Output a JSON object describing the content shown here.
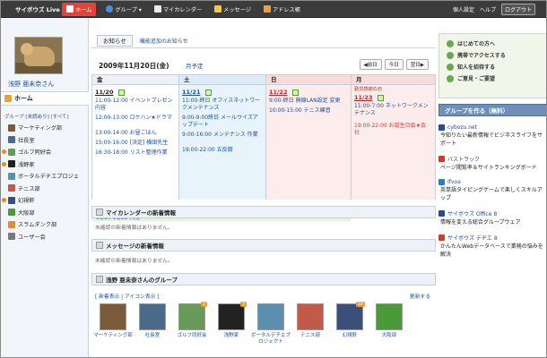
{
  "topbar": {
    "logo": "サイボウズ Live",
    "nav": [
      {
        "label": "ホーム",
        "active": true
      },
      {
        "label": "グループ ▾"
      },
      {
        "label": "マイカレンダー"
      },
      {
        "label": "メッセージ"
      },
      {
        "label": "アドレス帳"
      }
    ],
    "right": [
      "個人設定",
      "ヘルプ"
    ],
    "logout": "ログアウト"
  },
  "sidebar": {
    "username": "浅野 亜未奈さん",
    "home": "ホーム",
    "group_header": "グループ",
    "filter_unread": "[未読あり]",
    "filter_all": "[すべて]",
    "groups": [
      {
        "label": "マーケティング部",
        "dot": false
      },
      {
        "label": "社長室",
        "dot": false
      },
      {
        "label": "ゴルフ同好会",
        "dot": true
      },
      {
        "label": "浅野家",
        "dot": true
      },
      {
        "label": "ボータルデチエプロジェ",
        "dot": false
      },
      {
        "label": "テニス部",
        "dot": false
      },
      {
        "label": "幻視軒",
        "dot": true
      },
      {
        "label": "大阪部",
        "dot": false
      },
      {
        "label": "スラムダンク部",
        "dot": false
      },
      {
        "label": "ユーザー会",
        "dot": false
      }
    ]
  },
  "main": {
    "tab": "お知らせ",
    "breadcrumb_link": "機能追加のお知らせ",
    "calendar": {
      "date_title": "2009年11月20日(金)",
      "month_link": "月予定",
      "prev": "◀前日",
      "today": "今日",
      "next": "翌日▶",
      "columns": [
        {
          "head": "金",
          "date": "11/20",
          "holiday": "",
          "events": [
            {
              "time": "11:00-12:00",
              "text": "イベントプレゼン内容"
            },
            {
              "time": "12:00-13:00",
              "text": "ロケハン★ドラマ"
            },
            {
              "time": "13:00-14:00",
              "text": "お昼ごはん"
            },
            {
              "time": "15:00-16:00",
              "text": "[決定] 横田先生"
            },
            {
              "time": "16:30-18:00",
              "text": "リスト整理作業"
            }
          ]
        },
        {
          "head": "土",
          "date": "11/21",
          "holiday": "",
          "events": [
            {
              "time": "11:00-終日",
              "text": "オフィスネットワークメンテナンス"
            },
            {
              "time": "9:00-9:00終日",
              "text": "メールウイズアップデート"
            },
            {
              "time": "9:00-16:00",
              "text": "メンテナンス 作業"
            },
            {
              "time": "19:00-22:00",
              "text": "五反田"
            }
          ]
        },
        {
          "head": "日",
          "date": "11/22",
          "holiday": "",
          "events": [
            {
              "time": "9:00-終日",
              "text": "無線LAN設定 変更"
            },
            {
              "time": "10:00-15:00",
              "text": "テニス練習"
            }
          ]
        },
        {
          "head": "月",
          "date": "11/23",
          "holiday": "勤労感謝の日",
          "events": [
            {
              "time": "11:00-7:00",
              "text": "ネットワークメンテナンス"
            },
            {
              "time": "19:00-22:00",
              "text": "お誕生日会★会 社",
              "red": true
            }
          ]
        }
      ],
      "multiday": "11/20-11/22  大阪"
    },
    "mycal_title": "マイカレンダーの新着情報",
    "mycal_empty": "未確認の新着情報はありません。",
    "msg_title": "メッセージの新着情報",
    "msg_empty": "未確認の新着情報はありません。",
    "groups_title": "浅野 亜未奈さんのグループ",
    "groups_opts": "[ 新着表示 | アイコン表示 ]",
    "groups_update": "更新する",
    "group_icons": [
      {
        "label": "マーケティング部",
        "badge": "",
        "color": "#7b5b3a"
      },
      {
        "label": "社長室",
        "badge": "",
        "color": "#4a6b8a"
      },
      {
        "label": "ゴルフ同好会",
        "badge": "2",
        "color": "#6a9a5a"
      },
      {
        "label": "浅野家",
        "badge": "2",
        "color": "#222222"
      },
      {
        "label": "ボータルデチエプロジェクト",
        "badge": "",
        "color": "#5a8fb0"
      },
      {
        "label": "テニス部",
        "badge": "",
        "color": "#c25a4a"
      },
      {
        "label": "幻視軒",
        "badge": "10",
        "color": "#3a4f7a"
      },
      {
        "label": "大阪部",
        "badge": "",
        "color": "#4a9a3a"
      }
    ]
  },
  "right": {
    "links": [
      "はじめての方へ",
      "携帯でアクセスする",
      "知人を招待する",
      "ご意見・ご要望"
    ],
    "make_group": "グループを作る（無料）",
    "ads": [
      {
        "title": "cybozu.net",
        "text": "今知りたい最新情報でビジネスライフをサポート",
        "color": "#1a4fa3"
      },
      {
        "title": "パストラック",
        "text": "ページ閲覧率＆サイトランキングボード",
        "color": "#d13b2d"
      },
      {
        "title": "Ifvoa",
        "text": "英単語タイピングゲームで楽しくスキルアップ",
        "color": "#2a7fc2"
      },
      {
        "title": "サイボウズ Office 8",
        "text": "情報を変える総合グループウェア",
        "color": "#1a4fa3"
      },
      {
        "title": "サイボウズ デヂエ 8",
        "text": "かんたんWebデータベースで業務の悩みを解決",
        "color": "#d13b2d"
      }
    ]
  }
}
